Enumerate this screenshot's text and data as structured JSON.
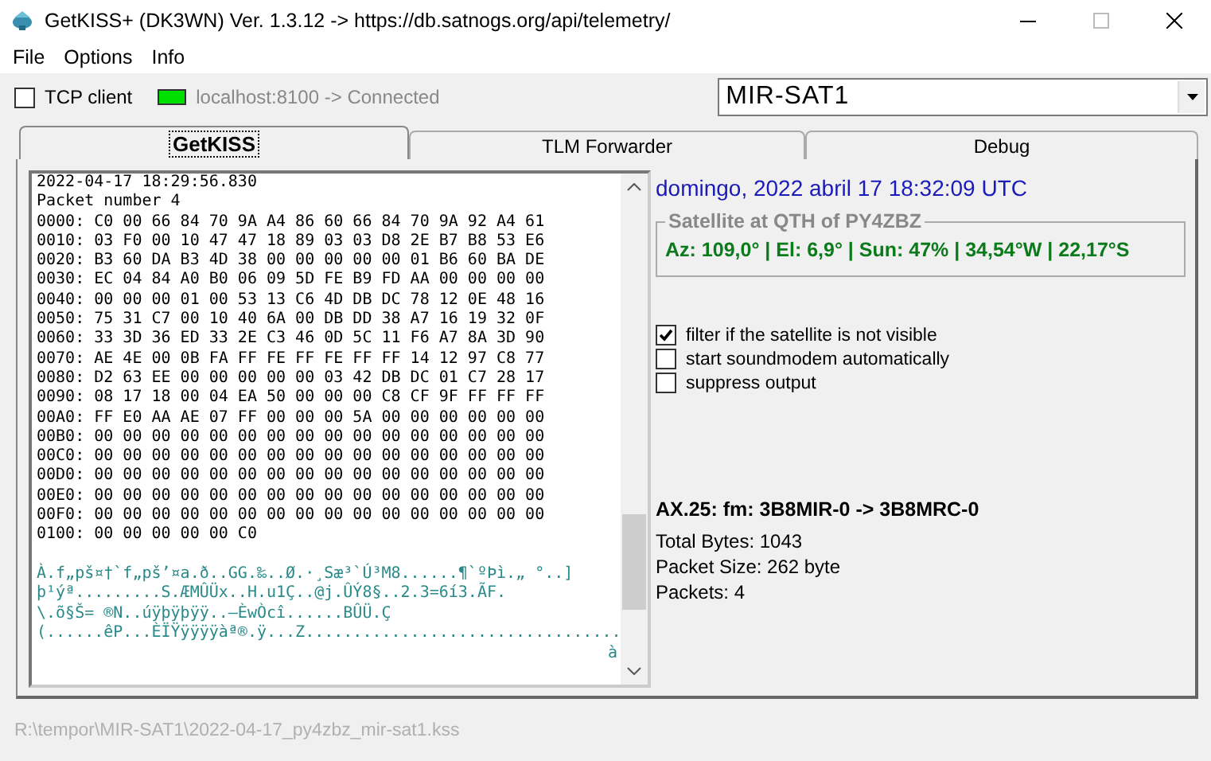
{
  "window": {
    "title": "GetKISS+ (DK3WN) Ver. 1.3.12 -> https://db.satnogs.org/api/telemetry/"
  },
  "menu": [
    "File",
    "Options",
    "Info"
  ],
  "toolbar": {
    "tcp_client": {
      "label": "TCP client",
      "checked": false
    },
    "connection": {
      "text": "localhost:8100 -> Connected",
      "connected": true
    },
    "satellite_select": {
      "value": "MIR-SAT1"
    }
  },
  "tabs": [
    {
      "label": "GetKISS",
      "selected": true
    },
    {
      "label": "TLM Forwarder",
      "selected": false
    },
    {
      "label": "Debug",
      "selected": false
    }
  ],
  "log": {
    "hex_lines": [
      "2022-04-17 18:29:56.830",
      "Packet number 4",
      "0000: C0 00 66 84 70 9A A4 86 60 66 84 70 9A 92 A4 61",
      "0010: 03 F0 00 10 47 47 18 89 03 03 D8 2E B7 B8 53 E6",
      "0020: B3 60 DA B3 4D 38 00 00 00 00 00 01 B6 60 BA DE",
      "0030: EC 04 84 A0 B0 06 09 5D FE B9 FD AA 00 00 00 00",
      "0040: 00 00 00 01 00 53 13 C6 4D DB DC 78 12 0E 48 16",
      "0050: 75 31 C7 00 10 40 6A 00 DB DD 38 A7 16 19 32 0F",
      "0060: 33 3D 36 ED 33 2E C3 46 0D 5C 11 F6 A7 8A 3D 90",
      "0070: AE 4E 00 0B FA FF FE FF FE FF FF 14 12 97 C8 77",
      "0080: D2 63 EE 00 00 00 00 00 03 42 DB DC 01 C7 28 17",
      "0090: 08 17 18 00 04 EA 50 00 00 00 C8 CF 9F FF FF FF",
      "00A0: FF E0 AA AE 07 FF 00 00 00 5A 00 00 00 00 00 00",
      "00B0: 00 00 00 00 00 00 00 00 00 00 00 00 00 00 00 00",
      "00C0: 00 00 00 00 00 00 00 00 00 00 00 00 00 00 00 00",
      "00D0: 00 00 00 00 00 00 00 00 00 00 00 00 00 00 00 00",
      "00E0: 00 00 00 00 00 00 00 00 00 00 00 00 00 00 00 00",
      "00F0: 00 00 00 00 00 00 00 00 00 00 00 00 00 00 00 00",
      "0100: 00 00 00 00 00 C0"
    ],
    "ascii_lines": [
      "À.f„pš¤†`f„pš’¤a.ð..GG.‰..Ø.·¸Sæ³`Ú³M8......¶`ºÞì.„ °..]",
      "þ¹ýª.........S.ÆMÛÜx..H.u1Ç..@j.ÛÝ8§..2.3=6í3.ÃF.",
      "\\.õ§Š= ®N..úÿþÿþÿÿ..—ÈwÒcî......BÛÜ.Ç",
      "(......êP...ÈÏŸÿÿÿÿàª®.ÿ...Z.................................",
      "à"
    ]
  },
  "info": {
    "datetime": "domingo, 2022 abril 17  18:32:09 UTC",
    "satellite_group": {
      "title": "Satellite at QTH of PY4ZBZ",
      "position": "Az: 109,0° | El: 6,9° | Sun: 47% | 34,54°W | 22,17°S"
    },
    "options": [
      {
        "label": "filter if the satellite is not visible",
        "checked": true
      },
      {
        "label": "start soundmodem automatically",
        "checked": false
      },
      {
        "label": "suppress output",
        "checked": false
      }
    ],
    "ax25": "AX.25: fm: 3B8MIR-0 -> 3B8MRC-0",
    "stats": [
      "Total Bytes: 1043",
      "Packet Size: 262 byte",
      "Packets: 4"
    ]
  },
  "status_bar": {
    "path": "R:\\tempor\\MIR-SAT1\\2022-04-17_py4zbz_mir-sat1.kss"
  }
}
